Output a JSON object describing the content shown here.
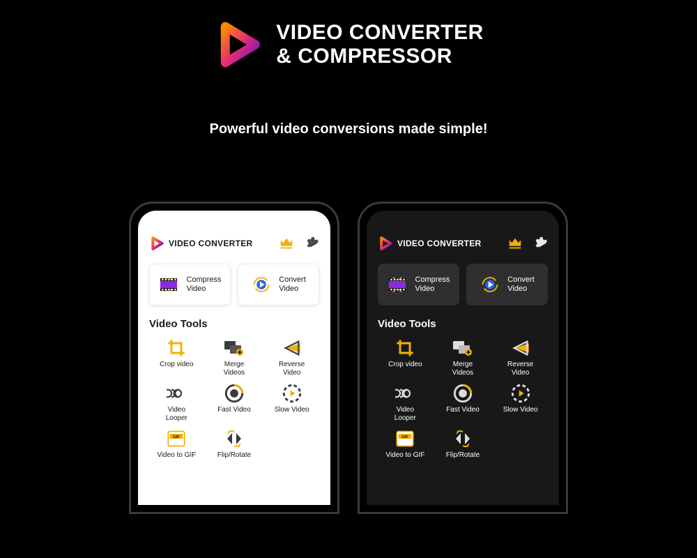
{
  "header": {
    "title_line1": "VIDEO CONVERTER",
    "title_line2": "& COMPRESSOR"
  },
  "tagline": "Powerful video conversions made simple!",
  "app": {
    "title": "VIDEO CONVERTER",
    "primary": [
      {
        "label_line1": "Compress",
        "label_line2": "Video"
      },
      {
        "label_line1": "Convert",
        "label_line2": "Video"
      }
    ],
    "section_title": "Video Tools",
    "tools": [
      {
        "label_line1": "Crop video",
        "label_line2": ""
      },
      {
        "label_line1": "Merge",
        "label_line2": "Videos"
      },
      {
        "label_line1": "Reverse",
        "label_line2": "Video"
      },
      {
        "label_line1": "Video",
        "label_line2": "Looper"
      },
      {
        "label_line1": "Fast Video",
        "label_line2": ""
      },
      {
        "label_line1": "Slow Video",
        "label_line2": ""
      },
      {
        "label_line1": "Video to GIF",
        "label_line2": ""
      },
      {
        "label_line1": "Flip/Rotate",
        "label_line2": ""
      }
    ]
  },
  "colors": {
    "accent_gold": "#f2b200",
    "logo_grad_a": "#ff8a00",
    "logo_grad_b": "#e52e71",
    "logo_grad_c": "#6a11cb"
  }
}
